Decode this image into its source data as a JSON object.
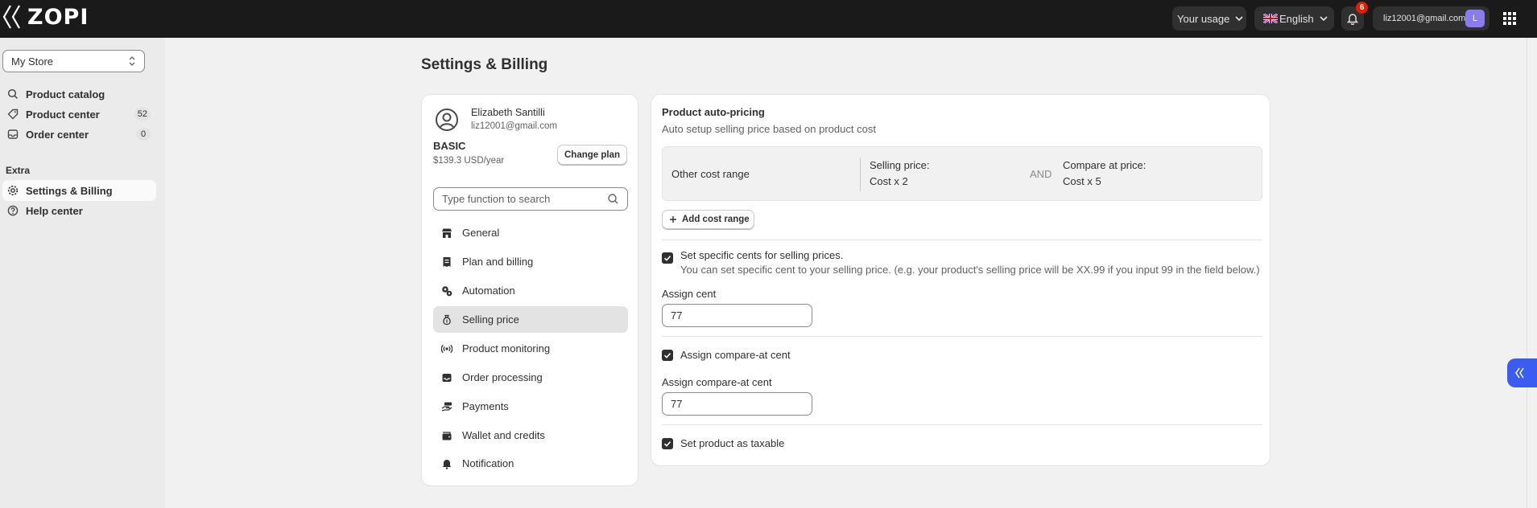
{
  "topbar": {
    "logo": "ZOPI",
    "usage_label": "Your usage",
    "language_label": "English",
    "notification_count": "6",
    "account_email": "liz12001@gmail.com",
    "avatar_initial": "L"
  },
  "sidebar": {
    "store": "My Store",
    "items": [
      {
        "label": "Product catalog",
        "icon": "search-icon"
      },
      {
        "label": "Product center",
        "icon": "tag-icon",
        "count": "52"
      },
      {
        "label": "Order center",
        "icon": "inbox-icon",
        "count": "0"
      }
    ],
    "section_extra": "Extra",
    "extra_items": [
      {
        "label": "Settings & Billing",
        "icon": "gear-icon",
        "active": true
      },
      {
        "label": "Help center",
        "icon": "help-icon"
      }
    ]
  },
  "page": {
    "title": "Settings & Billing"
  },
  "profile": {
    "name": "Elizabeth Santilli",
    "email": "liz12001@gmail.com",
    "plan": "BASIC",
    "price": "$139.3 USD/year",
    "change_plan": "Change plan",
    "search_placeholder": "Type function to search"
  },
  "menu": [
    {
      "label": "General",
      "icon": "store-icon"
    },
    {
      "label": "Plan and billing",
      "icon": "receipt-icon"
    },
    {
      "label": "Automation",
      "icon": "automation-icon"
    },
    {
      "label": "Selling price",
      "icon": "money-bag-icon",
      "active": true
    },
    {
      "label": "Product monitoring",
      "icon": "broadcast-icon"
    },
    {
      "label": "Order processing",
      "icon": "inbox-icon"
    },
    {
      "label": "Payments",
      "icon": "hand-money-icon"
    },
    {
      "label": "Wallet and credits",
      "icon": "wallet-icon"
    },
    {
      "label": "Notification",
      "icon": "bell-icon"
    }
  ],
  "pricing": {
    "title": "Product auto-pricing",
    "subtitle": "Auto setup selling price based on product cost",
    "range_label": "Other cost range",
    "selling_price_label": "Selling price:",
    "selling_price_value": "Cost x 2",
    "and_label": "AND",
    "compare_price_label": "Compare at price:",
    "compare_price_value": "Cost x 5",
    "add_range": "Add cost range",
    "specific_cents_label": "Set specific cents for selling prices.",
    "specific_cents_help": "You can set specific cent to your selling price. (e.g. your product's selling price will be XX.99 if you input 99 in the field below.)",
    "assign_cent_label": "Assign cent",
    "assign_cent_value": "77",
    "compare_cent_check_label": "Assign compare-at cent",
    "compare_cent_label": "Assign compare-at cent",
    "compare_cent_value": "77",
    "taxable_label": "Set product as taxable"
  },
  "colors": {
    "topbar": "#1a1a1a",
    "accent": "#3b5cf0",
    "badge": "#e51c00",
    "avatar": "#8a7cf0"
  }
}
